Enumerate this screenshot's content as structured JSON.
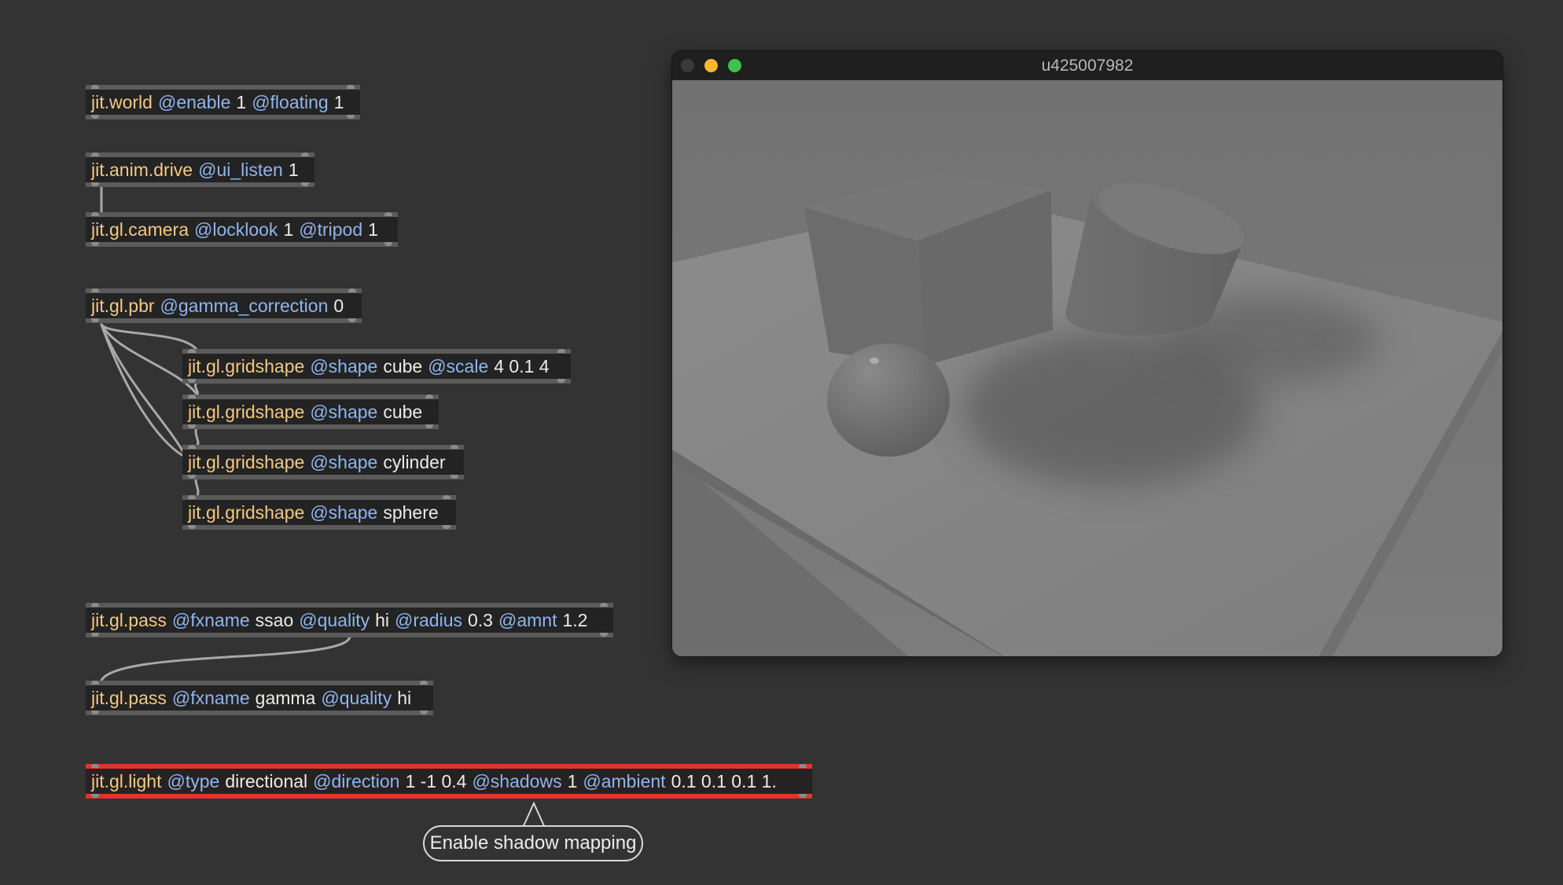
{
  "objects": [
    {
      "id": "world",
      "tokens": [
        {
          "t": "jit.world",
          "k": "cls"
        },
        {
          "t": "@enable",
          "k": "attr"
        },
        {
          "t": "1",
          "k": "val"
        },
        {
          "t": "@floating",
          "k": "attr"
        },
        {
          "t": "1",
          "k": "val"
        }
      ]
    },
    {
      "id": "anim",
      "tokens": [
        {
          "t": "jit.anim.drive",
          "k": "cls"
        },
        {
          "t": "@ui_listen",
          "k": "attr"
        },
        {
          "t": "1",
          "k": "val"
        }
      ]
    },
    {
      "id": "camera",
      "tokens": [
        {
          "t": "jit.gl.camera",
          "k": "cls"
        },
        {
          "t": "@locklook",
          "k": "attr"
        },
        {
          "t": "1",
          "k": "val"
        },
        {
          "t": "@tripod",
          "k": "attr"
        },
        {
          "t": "1",
          "k": "val"
        }
      ]
    },
    {
      "id": "pbr",
      "tokens": [
        {
          "t": "jit.gl.pbr",
          "k": "cls"
        },
        {
          "t": "@gamma_correction",
          "k": "attr"
        },
        {
          "t": "0",
          "k": "val"
        }
      ]
    },
    {
      "id": "grid1",
      "tokens": [
        {
          "t": "jit.gl.gridshape",
          "k": "cls"
        },
        {
          "t": "@shape",
          "k": "attr"
        },
        {
          "t": "cube",
          "k": "val"
        },
        {
          "t": "@scale",
          "k": "attr"
        },
        {
          "t": "4 0.1 4",
          "k": "val"
        }
      ]
    },
    {
      "id": "grid2",
      "tokens": [
        {
          "t": "jit.gl.gridshape",
          "k": "cls"
        },
        {
          "t": "@shape",
          "k": "attr"
        },
        {
          "t": "cube",
          "k": "val"
        }
      ]
    },
    {
      "id": "grid3",
      "tokens": [
        {
          "t": "jit.gl.gridshape",
          "k": "cls"
        },
        {
          "t": "@shape",
          "k": "attr"
        },
        {
          "t": "cylinder",
          "k": "val"
        }
      ]
    },
    {
      "id": "grid4",
      "tokens": [
        {
          "t": "jit.gl.gridshape",
          "k": "cls"
        },
        {
          "t": "@shape",
          "k": "attr"
        },
        {
          "t": "sphere",
          "k": "val"
        }
      ]
    },
    {
      "id": "pass1",
      "tokens": [
        {
          "t": "jit.gl.pass",
          "k": "cls"
        },
        {
          "t": "@fxname",
          "k": "attr"
        },
        {
          "t": "ssao",
          "k": "val"
        },
        {
          "t": "@quality",
          "k": "attr"
        },
        {
          "t": "hi",
          "k": "val"
        },
        {
          "t": "@radius",
          "k": "attr"
        },
        {
          "t": "0.3",
          "k": "val"
        },
        {
          "t": "@amnt",
          "k": "attr"
        },
        {
          "t": "1.2",
          "k": "val"
        }
      ]
    },
    {
      "id": "pass2",
      "tokens": [
        {
          "t": "jit.gl.pass",
          "k": "cls"
        },
        {
          "t": "@fxname",
          "k": "attr"
        },
        {
          "t": "gamma",
          "k": "val"
        },
        {
          "t": "@quality",
          "k": "attr"
        },
        {
          "t": "hi",
          "k": "val"
        }
      ]
    },
    {
      "id": "light",
      "selected": true,
      "tokens": [
        {
          "t": "jit.gl.light",
          "k": "cls"
        },
        {
          "t": "@type",
          "k": "attr"
        },
        {
          "t": "directional",
          "k": "val"
        },
        {
          "t": "@direction",
          "k": "attr"
        },
        {
          "t": "1 -1 0.4",
          "k": "val"
        },
        {
          "t": "@shadows",
          "k": "attr"
        },
        {
          "t": "1",
          "k": "val"
        },
        {
          "t": "@ambient",
          "k": "attr"
        },
        {
          "t": "0.1 0.1 0.1 1.",
          "k": "val"
        }
      ]
    }
  ],
  "window": {
    "title": "u425007982",
    "traffic_lights": {
      "close": "#3a3a3a",
      "minimize": "#f5b82e",
      "zoom": "#3fc14b"
    }
  },
  "tooltip": {
    "text": "Enable shadow mapping"
  },
  "colors": {
    "class": "#f3c982",
    "attribute": "#8fb5ee",
    "value": "#ecebe5",
    "selection": "#e0352a",
    "canvas": "#333333"
  }
}
